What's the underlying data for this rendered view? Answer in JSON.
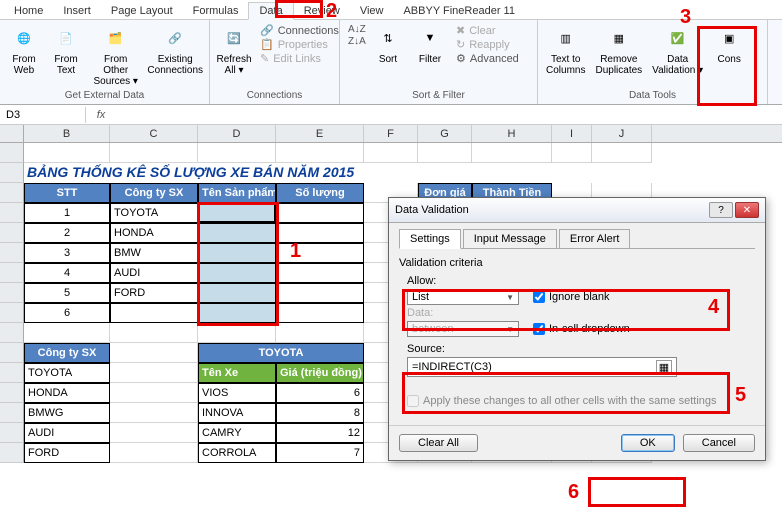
{
  "tabs": [
    "Home",
    "Insert",
    "Page Layout",
    "Formulas",
    "Data",
    "Review",
    "View",
    "ABBYY FineReader 11"
  ],
  "active_tab": "Data",
  "ribbon": {
    "ext": {
      "fromWeb": "From\nWeb",
      "fromText": "From\nText",
      "fromOther": "From Other\nSources ▾",
      "existing": "Existing\nConnections",
      "label": "Get External Data"
    },
    "conn": {
      "refresh": "Refresh\nAll ▾",
      "connections": "Connections",
      "properties": "Properties",
      "editLinks": "Edit Links",
      "label": "Connections"
    },
    "sort": {
      "sortAZ": "A↓Z",
      "sortZA": "Z↓A",
      "sort": "Sort",
      "filter": "Filter",
      "clear": "Clear",
      "reapply": "Reapply",
      "advanced": "Advanced",
      "label": "Sort & Filter"
    },
    "tools": {
      "textToCols": "Text to\nColumns",
      "removeDup": "Remove\nDuplicates",
      "dataVal": "Data\nValidation ▾",
      "cons": "Cons",
      "label": "Data Tools"
    }
  },
  "namebox": "D3",
  "fx": "fx",
  "cols": [
    "B",
    "C",
    "D",
    "E",
    "F",
    "G",
    "H",
    "I",
    "J"
  ],
  "title": "BẢNG THỐNG KÊ SỐ LƯỢNG XE BÁN NĂM 2015",
  "headers": {
    "stt": "STT",
    "cty": "Công ty SX",
    "ten": "Tên Sản phẩm",
    "sl": "Số lượng",
    "dg": "Đơn giá",
    "tt": "Thành Tiền"
  },
  "rows": [
    {
      "n": "1",
      "c": "TOYOTA"
    },
    {
      "n": "2",
      "c": "HONDA"
    },
    {
      "n": "3",
      "c": "BMW"
    },
    {
      "n": "4",
      "c": "AUDI"
    },
    {
      "n": "5",
      "c": "FORD"
    },
    {
      "n": "6",
      "c": ""
    }
  ],
  "lookup": {
    "cty_label": "Công ty SX",
    "companies": [
      "TOYOTA",
      "HONDA",
      "BMWG",
      "AUDI",
      "FORD"
    ],
    "brand": "TOYOTA",
    "tenxe": "Tên Xe",
    "gia": "Giá (triệu đồng)",
    "models": [
      [
        "VIOS",
        "6"
      ],
      [
        "INNOVA",
        "8"
      ],
      [
        "CAMRY",
        "12"
      ],
      [
        "CORROLA",
        "7"
      ]
    ]
  },
  "dialog": {
    "title": "Data Validation",
    "tabs": [
      "Settings",
      "Input Message",
      "Error Alert"
    ],
    "criteria": "Validation criteria",
    "allow": "Allow:",
    "allow_val": "List",
    "ignore": "Ignore blank",
    "incell": "In-cell dropdown",
    "data": "Data:",
    "data_val": "between",
    "source": "Source:",
    "source_val": "=INDIRECT(C3)",
    "apply": "Apply these changes to all other cells with the same settings",
    "clear": "Clear All",
    "ok": "OK",
    "cancel": "Cancel"
  },
  "anno": {
    "1": "1",
    "2": "2",
    "3": "3",
    "4": "4",
    "5": "5",
    "6": "6"
  }
}
